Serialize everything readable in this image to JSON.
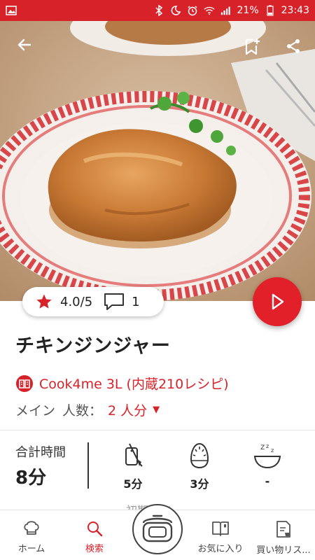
{
  "status_bar": {
    "battery": "21%",
    "time": "23:43",
    "icons": [
      "image-icon",
      "bluetooth-icon",
      "do-not-disturb-icon",
      "alarm-icon",
      "wifi-icon",
      "signal-icon",
      "battery-icon"
    ]
  },
  "recipe": {
    "title": "チキンジンジャー",
    "rating": "4.0/5",
    "comment_count": "1",
    "device": "Cook4me 3L (内蔵210レシピ)",
    "category": "メイン",
    "servings_label": "人数：",
    "servings_value": "2 人分",
    "total_time_label": "合計時間",
    "total_time_value": "8分",
    "prep_time": "5分",
    "cook_time": "3分",
    "rest_time": "-",
    "peek_text": "初期設定"
  },
  "nav": {
    "home": "ホーム",
    "search": "検索",
    "favorites": "お気に入り",
    "shopping": "買い物リス..."
  },
  "colors": {
    "accent": "#d8222a",
    "play": "#e2202a"
  }
}
